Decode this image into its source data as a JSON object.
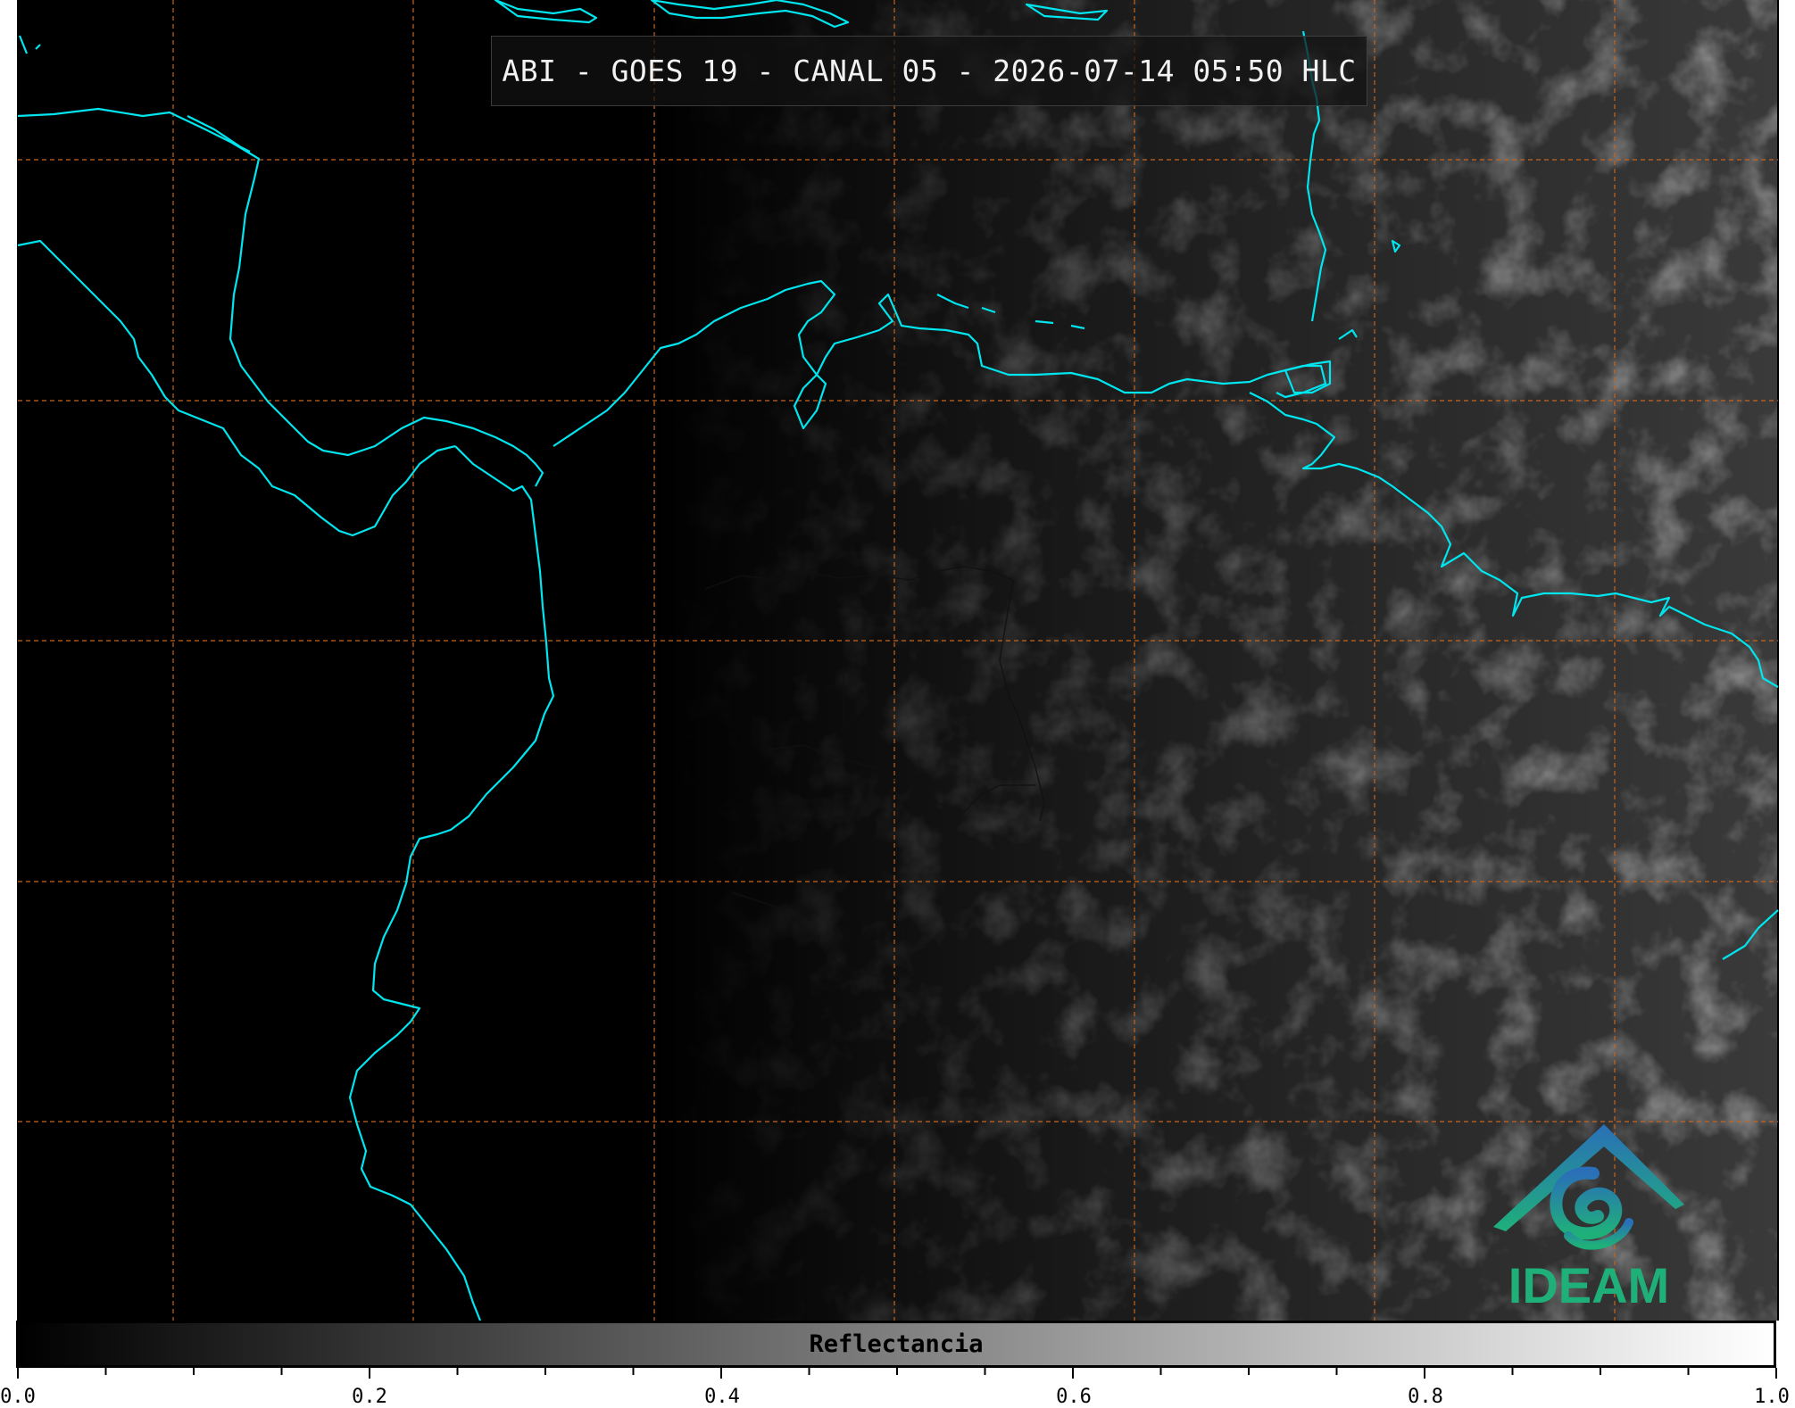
{
  "title": "ABI - GOES 19 - CANAL 05 - 2026-07-14 05:50 HLC",
  "colorbar": {
    "label": "Reflectancia",
    "min": 0.0,
    "max": 1.0,
    "tick_labels": [
      "0.0",
      "0.2",
      "0.4",
      "0.6",
      "0.8",
      "1.0"
    ],
    "colormap": [
      "#000000",
      "#ffffff"
    ]
  },
  "logo": {
    "text": "IDEAM",
    "color": "#1fb07a",
    "roof_color": "#2a6fb8"
  },
  "colors": {
    "coastline": "#00e5ee",
    "gridline": "#c8641e",
    "background": "#000000"
  }
}
